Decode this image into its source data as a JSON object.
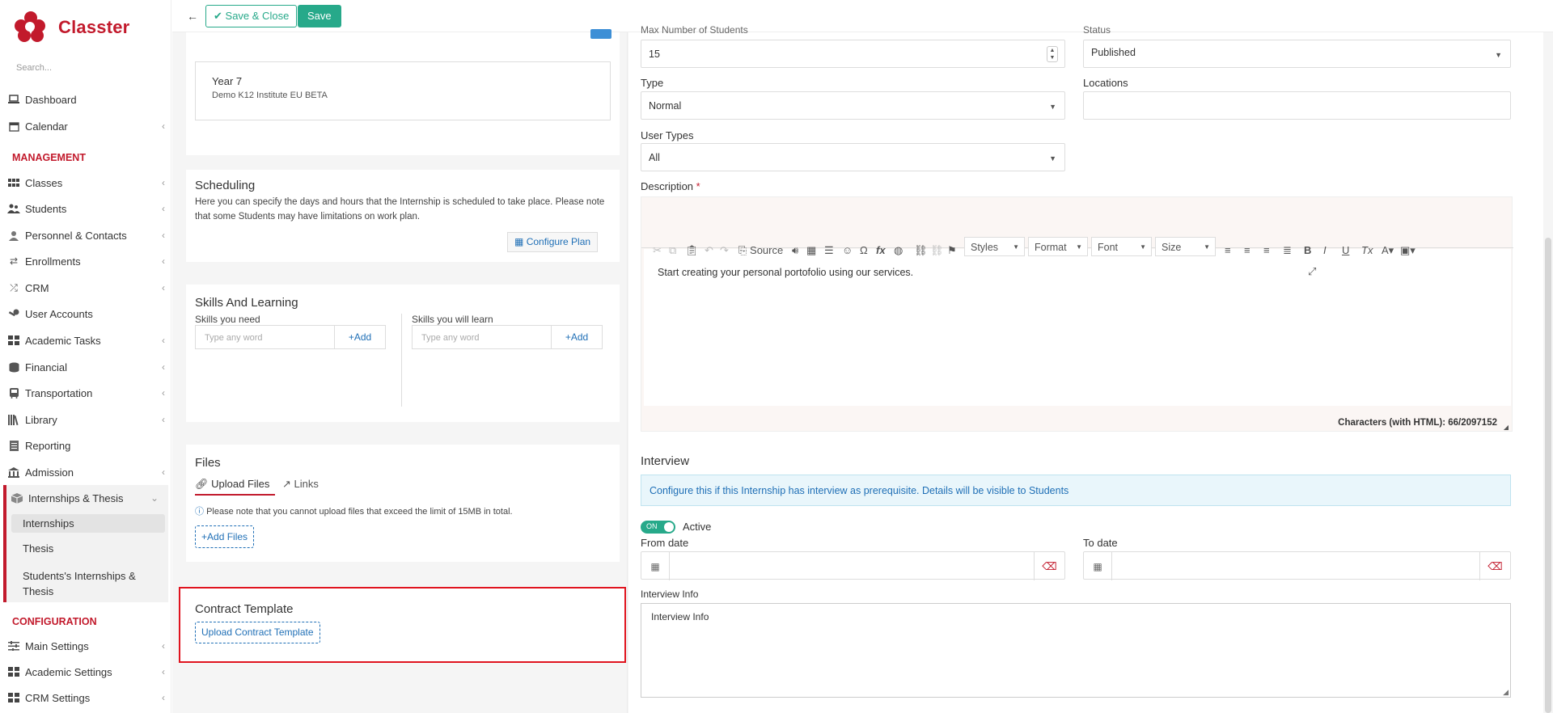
{
  "app": {
    "name": "Classter",
    "search_placeholder": "Search...",
    "brand_color": "#c21a2c",
    "accent_color": "#27a98a"
  },
  "sidebar": {
    "items_top": [
      {
        "label": "Dashboard",
        "icon": "laptop-icon"
      },
      {
        "label": "Calendar",
        "icon": "calendar-icon"
      }
    ],
    "management_title": "MANAGEMENT",
    "management": [
      {
        "label": "Classes",
        "icon": "grid-icon"
      },
      {
        "label": "Students",
        "icon": "users-icon"
      },
      {
        "label": "Personnel & Contacts",
        "icon": "user-icon"
      },
      {
        "label": "Enrollments",
        "icon": "exchange-icon"
      },
      {
        "label": "CRM",
        "icon": "shuffle-icon"
      },
      {
        "label": "User Accounts",
        "icon": "key-icon"
      },
      {
        "label": "Academic Tasks",
        "icon": "tasks-icon"
      },
      {
        "label": "Financial",
        "icon": "coins-icon"
      },
      {
        "label": "Transportation",
        "icon": "bus-icon"
      },
      {
        "label": "Library",
        "icon": "books-icon"
      },
      {
        "label": "Reporting",
        "icon": "report-icon"
      },
      {
        "label": "Admission",
        "icon": "building-icon"
      },
      {
        "label": "Internships & Thesis",
        "icon": "box-icon"
      }
    ],
    "sub_items": [
      "Internships",
      "Thesis",
      "Students's Internships &",
      "Thesis"
    ],
    "configuration_title": "CONFIGURATION",
    "configuration": [
      {
        "label": "Main Settings",
        "icon": "sliders-icon"
      },
      {
        "label": "Academic Settings",
        "icon": "grid-icon"
      },
      {
        "label": "CRM Settings",
        "icon": "grid-icon"
      }
    ]
  },
  "toolbar": {
    "save_close": "Save & Close",
    "save": "Save"
  },
  "year_card": {
    "title": "Year 7",
    "subtitle": "Demo K12 Institute EU BETA"
  },
  "scheduling": {
    "title": "Scheduling",
    "text1": "Here you can specify the days and hours that the Internship is scheduled to take place. Please note",
    "text2": "that some Students may have limitations on work plan.",
    "button": "Configure Plan"
  },
  "skills": {
    "title": "Skills And Learning",
    "need_label": "Skills you need",
    "learn_label": "Skills you will learn",
    "placeholder": "Type any word",
    "add": "Add"
  },
  "files": {
    "title": "Files",
    "tab_upload": "Upload Files",
    "tab_links": "Links",
    "note": "Please note that you cannot upload files that exceed the limit of 15MB in total.",
    "add_button": "Add Files"
  },
  "contract": {
    "title": "Contract Template",
    "button": "Upload Contract Template"
  },
  "form": {
    "max_students_label": "Max Number of Students",
    "max_students": "15",
    "status_label": "Status",
    "status": "Published",
    "type_label": "Type",
    "type": "Normal",
    "locations_label": "Locations",
    "user_types_label": "User Types",
    "user_types": "All",
    "description_label": "Description",
    "description_text": "Start creating your personal portofolio using our services.",
    "char_count": "Characters (with HTML): 66/2097152",
    "toolbar": {
      "source": "Source",
      "styles": "Styles",
      "format": "Format",
      "font": "Font",
      "size": "Size"
    }
  },
  "interview": {
    "title": "Interview",
    "info_text": "Configure this if this Internship has interview as prerequisite. Details will be visible to Students",
    "toggle_on": "ON",
    "toggle_label": "Active",
    "from_label": "From date",
    "to_label": "To date",
    "info_label": "Interview Info",
    "info_value": "Interview Info"
  }
}
